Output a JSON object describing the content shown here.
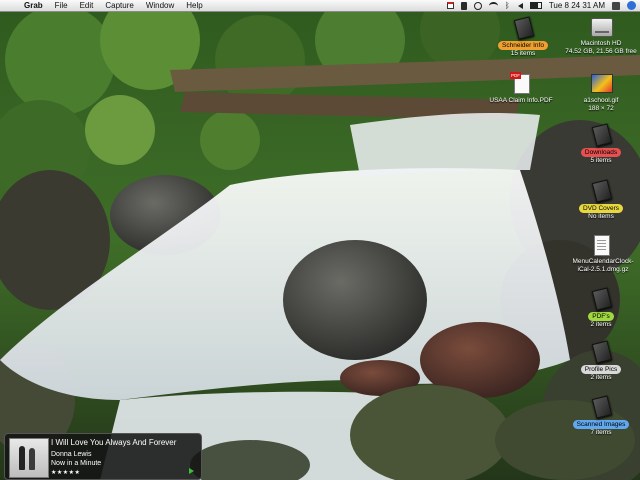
{
  "menubar": {
    "apple_glyph": "",
    "app_name": "Grab",
    "menus": [
      "File",
      "Edit",
      "Capture",
      "Window",
      "Help"
    ],
    "clock": "Tue 8 24 31 AM"
  },
  "desktop_icons": [
    {
      "label": "Macintosh HD",
      "sub": "74.52 GB, 21.56 GB free",
      "kind": "drive-icon",
      "label_color": ""
    },
    {
      "label": "Schneider Info",
      "sub": "15 items",
      "kind": "folder-icon",
      "label_color": "#f0a030"
    },
    {
      "label": "USAA Claim Info.PDF",
      "sub": "",
      "kind": "pdf-icon",
      "label_color": ""
    },
    {
      "label": "a1school.gif",
      "sub": "188 × 72",
      "kind": "gif-icon",
      "label_color": ""
    },
    {
      "label": "Downloads",
      "sub": "5 items",
      "kind": "folder-icon",
      "label_color": "#e85050"
    },
    {
      "label": "DVD Covers",
      "sub": "No items",
      "kind": "folder-icon",
      "label_color": "#e8d840"
    },
    {
      "label": "MenuCalendarClock-iCal-2.5.1.dmg.gz",
      "sub": "",
      "kind": "document-icon",
      "label_color": ""
    },
    {
      "label": "PDF's",
      "sub": "2 items",
      "kind": "folder-icon",
      "label_color": "#a0d840"
    },
    {
      "label": "Profile Pics",
      "sub": "2 items",
      "kind": "folder-icon",
      "label_color": "#d8d8d8"
    },
    {
      "label": "Scanned Images",
      "sub": "7 items",
      "kind": "folder-icon",
      "label_color": "#60a8f0"
    }
  ],
  "now_playing": {
    "title": "I Will Love You Always And Forever",
    "artist": "Donna Lewis",
    "album": "Now in a Minute",
    "rating_stars": "★★★★★",
    "rating_value": 5
  }
}
